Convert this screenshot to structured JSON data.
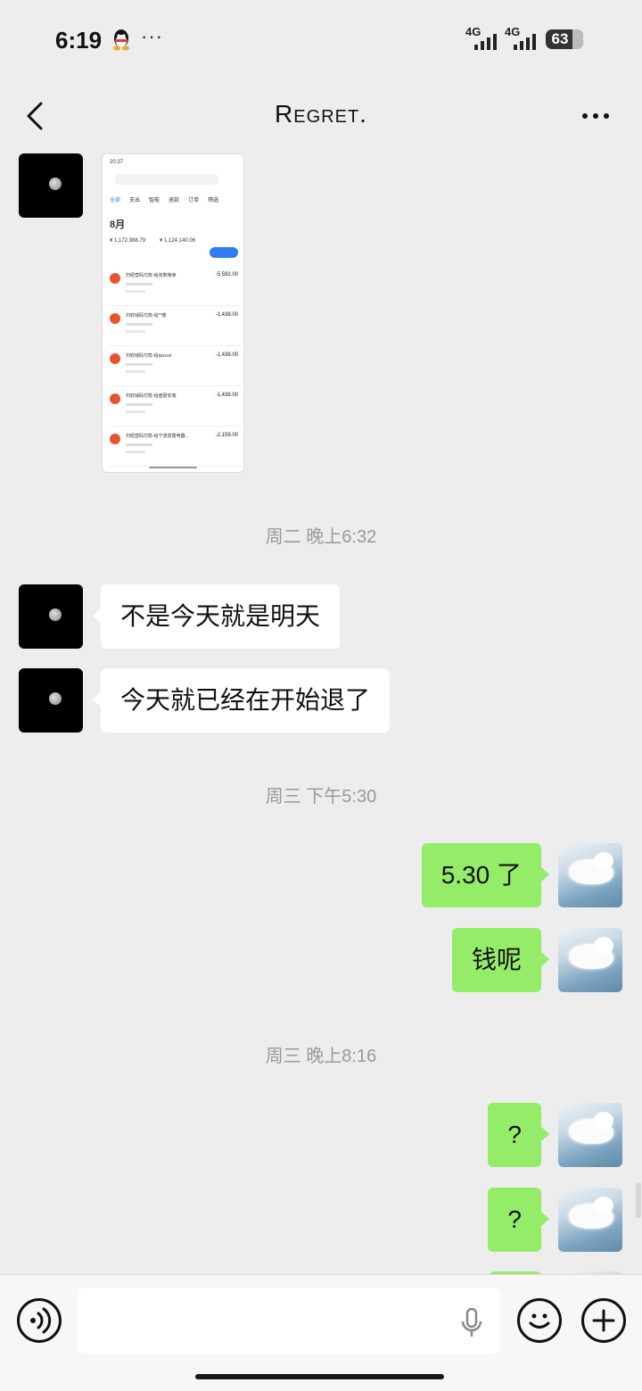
{
  "status_bar": {
    "time": "6:19",
    "more": "···",
    "signal1_label": "4G",
    "signal2_label": "4G",
    "battery": "63"
  },
  "header": {
    "title": "Regret."
  },
  "messages": {
    "ts1": "周二 晚上6:32",
    "m1": "不是今天就是明天",
    "m2": "今天就已经在开始退了",
    "ts2": "周三 下午5:30",
    "m3": "5.30 了",
    "m4": "钱呢",
    "ts3": "周三 晚上8:16",
    "m5": "?",
    "m6": "?"
  },
  "thumbnail": {
    "status_time": "20:37",
    "tabs": [
      "全部",
      "支出",
      "智能",
      "退款",
      "订单",
      "筛选"
    ],
    "month": "8月",
    "expense_total": "¥ 1,172,988.79",
    "income_total": "¥ 1,124,140.06",
    "rows": [
      {
        "title": "扫经营码付款-给张数粮食",
        "amount": "-5,592.00"
      },
      {
        "title": "扫收钱码付款-给**慷",
        "amount": "-1,438.00"
      },
      {
        "title": "扫收钱码付款-给qiuxun",
        "amount": "-1,438.00"
      },
      {
        "title": "扫收钱码付款-给盘厨安装",
        "amount": "-1,438.00"
      },
      {
        "title": "扫经营码付款-给宁波雷霆电器...",
        "amount": "-2,159.00"
      }
    ]
  },
  "colors": {
    "background": "#ededed",
    "bubble_right": "#95ec69",
    "bubble_left": "#ffffff",
    "timestamp": "#9a9a9a"
  }
}
